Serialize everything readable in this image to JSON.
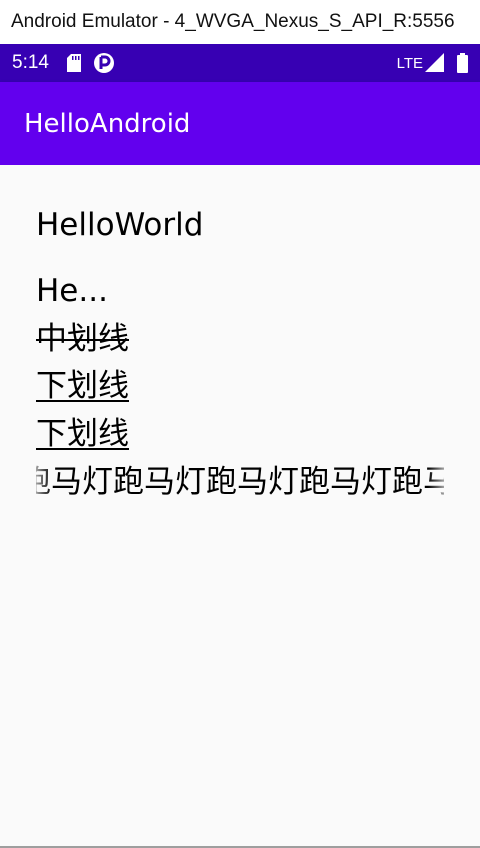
{
  "window": {
    "title": "Android Emulator - 4_WVGA_Nexus_S_API_R:5556"
  },
  "status_bar": {
    "time": "5:14",
    "network": "LTE",
    "icons": [
      "sd-card-icon",
      "play-protect-icon",
      "signal-icon",
      "battery-icon"
    ],
    "color": "#3700b3"
  },
  "app_bar": {
    "title": "HelloAndroid",
    "color": "#6200ee"
  },
  "content": {
    "hello_world": "HelloWorld",
    "ellipsized": "He...",
    "strikethrough": "中划线",
    "underline_1": "下划线",
    "underline_2": "下划线",
    "marquee": "跑马灯跑马灯跑马灯跑马灯跑马灯"
  }
}
